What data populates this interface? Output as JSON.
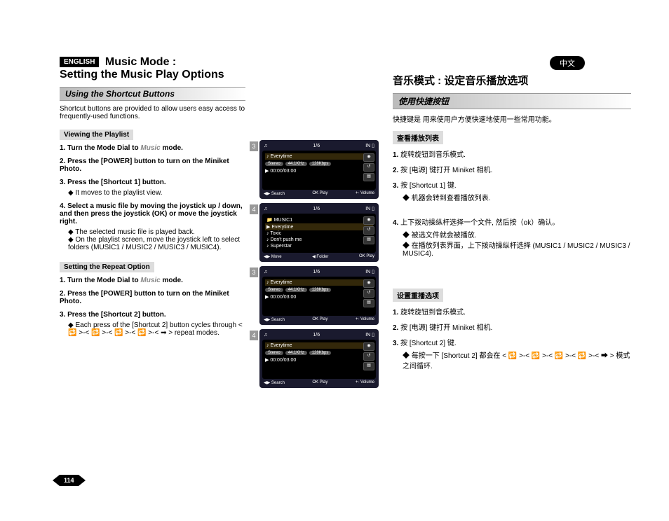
{
  "header": {
    "lang_badge_en": "ENGLISH",
    "lang_badge_cn": "中文",
    "title_line1": "Music Mode :",
    "title_line2": "Setting the Music Play Options",
    "cn_title": "音乐模式 : 设定音乐播放选项"
  },
  "left": {
    "section_title": "Using the Shortcut Buttons",
    "intro": "Shortcut buttons are provided to allow users easy access to frequently-used functions.",
    "view_playlist_head": "Viewing the Playlist",
    "view_steps": {
      "s1a": "Turn the Mode Dial to ",
      "s1_music": "Music",
      "s1b": " mode.",
      "s2": "Press the [POWER] button to turn on the Miniket Photo.",
      "s3": "Press the [Shortcut 1] button.",
      "s3_sub": "It moves to the playlist view.",
      "s4": "Select a music file by moving the joystick up / down, and then press the joystick (OK) or move the joystick right.",
      "s4_sub1": "The selected music file is played back.",
      "s4_sub2": "On the playlist screen, move the joystick left to select folders (MUSIC1 / MUSIC2 / MUSIC3 / MUSIC4)."
    },
    "repeat_head": "Setting the Repeat Option",
    "repeat_steps": {
      "s1a": "Turn the Mode Dial to ",
      "s1_music": "Music",
      "s1b": " mode.",
      "s2": "Press the [POWER] button to turn on the Miniket Photo.",
      "s3": "Press the [Shortcut 2] button.",
      "s3_sub": "Each press of the [Shortcut 2] button cycles through < 🔁 >-< 🔂 >-< 🔁 >-< 🔁 >-< ➡ > repeat modes."
    }
  },
  "right": {
    "section_title": "使用快捷按钮",
    "intro": "快捷键是 用来使用户方便快速地使用一些常用功能。",
    "view_head": "查看播放列表",
    "view_steps": {
      "s1": "旋转旋钮到音乐模式.",
      "s2": "按 [电源] 键打开 Miniket 相机.",
      "s3": "按 [Shortcut 1] 键.",
      "s3_sub": "机器会转到查看播放列表.",
      "s4": "上下拨动操纵杆选择一个文件,  然后按（ok）确认。",
      "s4_sub1": "被选文件就会被播放.",
      "s4_sub2": "在播放列表界面，上下拨动操纵杆选择 (MUSIC1 / MUSIC2 / MUSIC3 / MUSIC4)."
    },
    "repeat_head": "设置重播选项",
    "repeat_steps": {
      "s1": "旋转旋钮到音乐模式.",
      "s2": "按 [电源] 键打开 Miniket 相机.",
      "s3": "按 [Shortcut 2] 键.",
      "s3_sub": "每按一下 [Shortcut 2] 都会在 < 🔁 >-< 🔂 >-< 🔁 >-< 🔁 >-< ➡ > 模式之间循环."
    }
  },
  "screens": {
    "s1": {
      "num": "3",
      "counter": "1/6",
      "track": "Everytime",
      "stereo": "Stereo",
      "khz": "44.1KHz",
      "kbps": "128Kbps",
      "time": "00:00/03:00",
      "b1": "Search",
      "b2": "Play",
      "b3": "Volume",
      "b2p": "OK"
    },
    "s2": {
      "num": "4",
      "counter": "1/6",
      "folder": "MUSIC1",
      "t1": "Everytime",
      "t2": "Toxic",
      "t3": "Don't push me",
      "t4": "Superstar",
      "b1": "Move",
      "b2": "Folder",
      "b3": "Play",
      "b3p": "OK"
    },
    "s3": {
      "num": "3",
      "counter": "1/6",
      "track": "Everytime",
      "stereo": "Stereo",
      "khz": "44.1KHz",
      "kbps": "128Kbps",
      "time": "00:00/03:00",
      "b1": "Search",
      "b2": "Play",
      "b3": "Volume",
      "b2p": "OK"
    },
    "s4": {
      "num": "4",
      "counter": "1/6",
      "track": "Everytime",
      "stereo": "Stereo",
      "khz": "44.1KHz",
      "kbps": "128Kbps",
      "time": "00:00/03:00",
      "b1": "Search",
      "b2": "Play",
      "b3": "Volume",
      "b2p": "OK"
    }
  },
  "page_number": "114"
}
